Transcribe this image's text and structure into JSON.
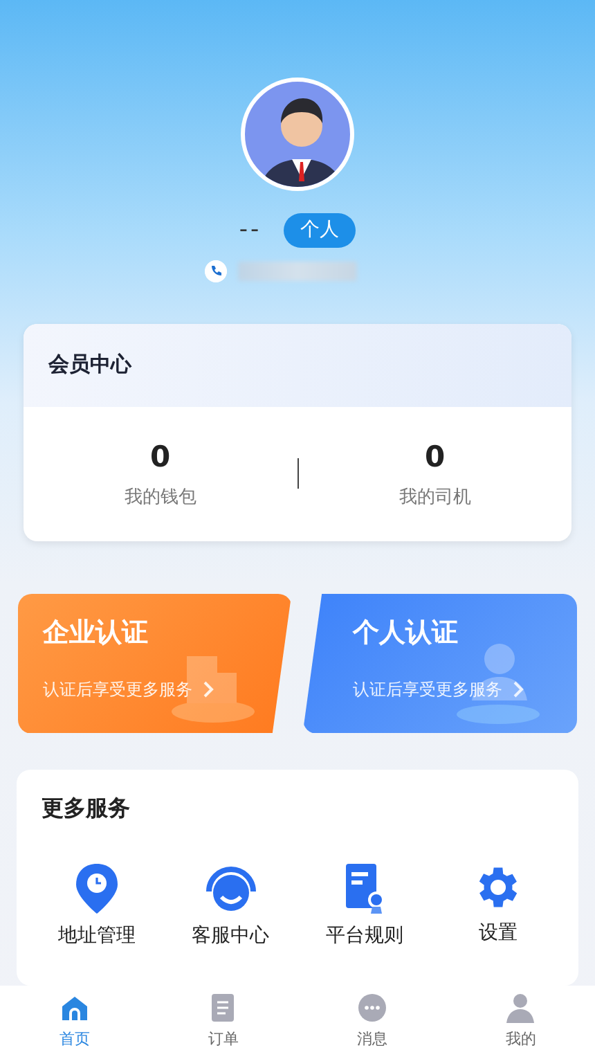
{
  "profile": {
    "name": "--",
    "badge": "个人"
  },
  "member_center": {
    "title": "会员中心",
    "stats": [
      {
        "value": "0",
        "label": "我的钱包"
      },
      {
        "value": "0",
        "label": "我的司机"
      }
    ]
  },
  "certifications": [
    {
      "kind": "enterprise",
      "title": "企业认证",
      "subtitle": "认证后享受更多服务"
    },
    {
      "kind": "personal",
      "title": "个人认证",
      "subtitle": "认证后享受更多服务"
    }
  ],
  "services": {
    "title": "更多服务",
    "items": [
      {
        "kind": "location",
        "label": "地址管理"
      },
      {
        "kind": "support",
        "label": "客服中心"
      },
      {
        "kind": "rules",
        "label": "平台规则"
      },
      {
        "kind": "settings",
        "label": "设置"
      }
    ]
  },
  "tab_bar": [
    {
      "kind": "home",
      "label": "首页",
      "selected": true
    },
    {
      "kind": "orders",
      "label": "订单",
      "selected": false
    },
    {
      "kind": "messages",
      "label": "消息",
      "selected": false
    },
    {
      "kind": "me",
      "label": "我的",
      "selected": false
    }
  ]
}
